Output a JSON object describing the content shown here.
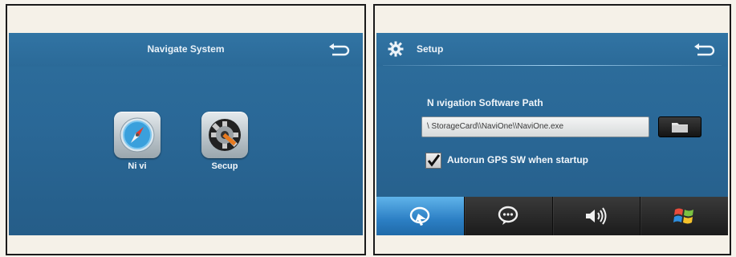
{
  "left_screen": {
    "title": "Navigate System",
    "apps": [
      {
        "label": "Ni vi",
        "icon": "compass-icon"
      },
      {
        "label": "Secup",
        "icon": "settings-gear-icon"
      }
    ],
    "back_icon": "back-arrow-icon"
  },
  "right_screen": {
    "title": "Setup",
    "header_icon": "gear-icon",
    "back_icon": "back-arrow-icon",
    "path_label": "N ıvigation Software Path",
    "path_value": "\\ StorageCard\\\\NaviOne\\\\NaviOne.exe",
    "browse_icon": "folder-icon",
    "checkbox_checked": true,
    "checkbox_label": "Autorun GPS SW when startup",
    "dock": [
      {
        "icon": "navigation-icon",
        "active": true
      },
      {
        "icon": "chat-bubble-icon",
        "active": false
      },
      {
        "icon": "speaker-volume-icon",
        "active": false
      },
      {
        "icon": "windows-logo-icon",
        "active": false
      }
    ]
  },
  "colors": {
    "screen_blue": "#2b6a98",
    "dock_active": "#3d8fd0",
    "dock_dark": "#1e1e1e",
    "frame_bg": "#f5f1e8"
  }
}
